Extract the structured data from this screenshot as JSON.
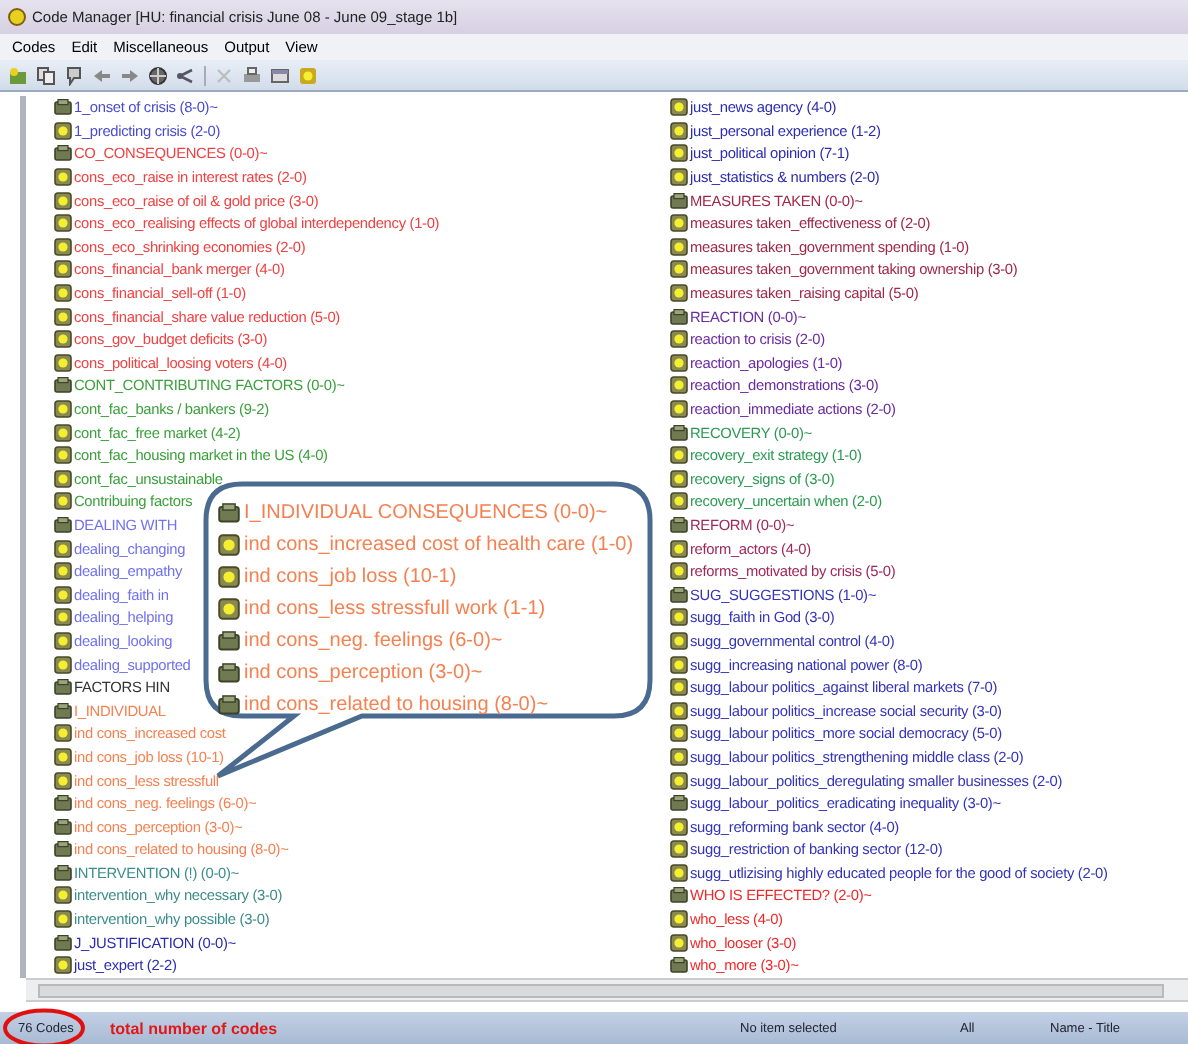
{
  "window": {
    "title": "Code Manager [HU: financial crisis June 08 - June 09_stage 1b]"
  },
  "menu": [
    "Codes",
    "Edit",
    "Miscellaneous",
    "Output",
    "View"
  ],
  "codes_left": [
    {
      "label": "1_onset of crisis (8-0)~",
      "kind": "group",
      "color": "#4a4ad0"
    },
    {
      "label": "1_predicting crisis (2-0)",
      "kind": "code",
      "color": "#4a4ad0"
    },
    {
      "label": "CO_CONSEQUENCES (0-0)~",
      "kind": "group",
      "color": "#f04040"
    },
    {
      "label": "cons_eco_raise in interest rates (2-0)",
      "kind": "code",
      "color": "#f04040"
    },
    {
      "label": "cons_eco_raise of oil & gold price (3-0)",
      "kind": "code",
      "color": "#f04040"
    },
    {
      "label": "cons_eco_realising effects of global interdependency (1-0)",
      "kind": "code",
      "color": "#f04040"
    },
    {
      "label": "cons_eco_shrinking economies (2-0)",
      "kind": "code",
      "color": "#f04040"
    },
    {
      "label": "cons_financial_bank merger (4-0)",
      "kind": "code",
      "color": "#f04040"
    },
    {
      "label": "cons_financial_sell-off (1-0)",
      "kind": "code",
      "color": "#f04040"
    },
    {
      "label": "cons_financial_share value reduction (5-0)",
      "kind": "code",
      "color": "#f04040"
    },
    {
      "label": "cons_gov_budget deficits (3-0)",
      "kind": "code",
      "color": "#f04040"
    },
    {
      "label": "cons_political_loosing voters (4-0)",
      "kind": "code",
      "color": "#f04040"
    },
    {
      "label": "CONT_CONTRIBUTING FACTORS (0-0)~",
      "kind": "group",
      "color": "#3aa03a"
    },
    {
      "label": "cont_fac_banks / bankers (9-2)",
      "kind": "code",
      "color": "#3aa03a"
    },
    {
      "label": "cont_fac_free market (4-2)",
      "kind": "code",
      "color": "#3aa03a"
    },
    {
      "label": "cont_fac_housing market in the US (4-0)",
      "kind": "code",
      "color": "#3aa03a"
    },
    {
      "label": "cont_fac_unsustainable",
      "kind": "code",
      "color": "#3aa03a"
    },
    {
      "label": "Contribuing factors",
      "kind": "code",
      "color": "#3aa03a"
    },
    {
      "label": "DEALING WITH",
      "kind": "group",
      "color": "#7070f0"
    },
    {
      "label": "dealing_changing",
      "kind": "code",
      "color": "#7070f0"
    },
    {
      "label": "dealing_empathy",
      "kind": "code",
      "color": "#7070f0"
    },
    {
      "label": "dealing_faith in",
      "kind": "code",
      "color": "#7070f0"
    },
    {
      "label": "dealing_helping",
      "kind": "code",
      "color": "#7070f0"
    },
    {
      "label": "dealing_looking",
      "kind": "code",
      "color": "#7070f0"
    },
    {
      "label": "dealing_supported",
      "kind": "code",
      "color": "#7070f0"
    },
    {
      "label": "FACTORS HIN",
      "kind": "group",
      "color": "#333333"
    },
    {
      "label": "I_INDIVIDUAL",
      "kind": "group",
      "color": "#f58050"
    },
    {
      "label": "ind cons_increased cost",
      "kind": "code",
      "color": "#f58050"
    },
    {
      "label": "ind cons_job loss (10-1)",
      "kind": "code",
      "color": "#f58050"
    },
    {
      "label": "ind cons_less stressfull",
      "kind": "code",
      "color": "#f58050"
    },
    {
      "label": "ind cons_neg. feelings (6-0)~",
      "kind": "group",
      "color": "#f58050"
    },
    {
      "label": "ind cons_perception (3-0)~",
      "kind": "group",
      "color": "#f58050"
    },
    {
      "label": "ind cons_related to housing (8-0)~",
      "kind": "group",
      "color": "#f58050"
    },
    {
      "label": "INTERVENTION (!) (0-0)~",
      "kind": "group",
      "color": "#3c8c8c"
    },
    {
      "label": "intervention_why necessary (3-0)",
      "kind": "code",
      "color": "#3c8c8c"
    },
    {
      "label": "intervention_why possible (3-0)",
      "kind": "code",
      "color": "#3c8c8c"
    },
    {
      "label": "J_JUSTIFICATION (0-0)~",
      "kind": "group",
      "color": "#2c2cb0"
    },
    {
      "label": "just_expert (2-2)",
      "kind": "code",
      "color": "#2c2cb0"
    }
  ],
  "codes_right": [
    {
      "label": "just_news agency (4-0)",
      "kind": "code",
      "color": "#2c2cb0"
    },
    {
      "label": "just_personal experience (1-2)",
      "kind": "code",
      "color": "#2c2cb0"
    },
    {
      "label": "just_political opinion (7-1)",
      "kind": "code",
      "color": "#2c2cb0"
    },
    {
      "label": "just_statistics & numbers (2-0)",
      "kind": "code",
      "color": "#2c2cb0"
    },
    {
      "label": "MEASURES TAKEN (0-0)~",
      "kind": "group",
      "color": "#a02848"
    },
    {
      "label": "measures taken_effectiveness of (2-0)",
      "kind": "code",
      "color": "#a02848"
    },
    {
      "label": "measures taken_government spending (1-0)",
      "kind": "code",
      "color": "#a02848"
    },
    {
      "label": "measures taken_government taking ownership (3-0)",
      "kind": "code",
      "color": "#a02848"
    },
    {
      "label": "measures taken_raising capital (5-0)",
      "kind": "code",
      "color": "#a02848"
    },
    {
      "label": "REACTION (0-0)~",
      "kind": "group",
      "color": "#6a2aa0"
    },
    {
      "label": "reaction to crisis (2-0)",
      "kind": "code",
      "color": "#6a2aa0"
    },
    {
      "label": "reaction_apologies (1-0)",
      "kind": "code",
      "color": "#6a2aa0"
    },
    {
      "label": "reaction_demonstrations (3-0)",
      "kind": "code",
      "color": "#6a2aa0"
    },
    {
      "label": "reaction_immediate actions (2-0)",
      "kind": "code",
      "color": "#6a2aa0"
    },
    {
      "label": "RECOVERY (0-0)~",
      "kind": "group",
      "color": "#2a9a50"
    },
    {
      "label": "recovery_exit strategy (1-0)",
      "kind": "code",
      "color": "#2a9a50"
    },
    {
      "label": "recovery_signs of (3-0)",
      "kind": "code",
      "color": "#2a9a50"
    },
    {
      "label": "recovery_uncertain when (2-0)",
      "kind": "code",
      "color": "#2a9a50"
    },
    {
      "label": "REFORM (0-0)~",
      "kind": "group",
      "color": "#a02858"
    },
    {
      "label": "reform_actors (4-0)",
      "kind": "code",
      "color": "#a02858"
    },
    {
      "label": "reforms_motivated by crisis (5-0)",
      "kind": "code",
      "color": "#a02858"
    },
    {
      "label": "SUG_SUGGESTIONS (1-0)~",
      "kind": "group",
      "color": "#3434b8"
    },
    {
      "label": "sugg_faith in God (3-0)",
      "kind": "code",
      "color": "#3434b8"
    },
    {
      "label": "sugg_governmental control (4-0)",
      "kind": "code",
      "color": "#3434b8"
    },
    {
      "label": "sugg_increasing national power (8-0)",
      "kind": "code",
      "color": "#3434b8"
    },
    {
      "label": "sugg_labour politics_against liberal markets (7-0)",
      "kind": "code",
      "color": "#3434b8"
    },
    {
      "label": "sugg_labour politics_increase social security (3-0)",
      "kind": "code",
      "color": "#3434b8"
    },
    {
      "label": "sugg_labour politics_more social democracy (5-0)",
      "kind": "code",
      "color": "#3434b8"
    },
    {
      "label": "sugg_labour politics_strengthening middle class (2-0)",
      "kind": "code",
      "color": "#3434b8"
    },
    {
      "label": "sugg_labour_politics_deregulating smaller businesses (2-0)",
      "kind": "code",
      "color": "#3434b8"
    },
    {
      "label": "sugg_labour_politics_eradicating inequality (3-0)~",
      "kind": "group",
      "color": "#3434b8"
    },
    {
      "label": "sugg_reforming bank sector (4-0)",
      "kind": "code",
      "color": "#3434b8"
    },
    {
      "label": "sugg_restriction of banking sector (12-0)",
      "kind": "code",
      "color": "#3434b8"
    },
    {
      "label": "sugg_utlizising highly educated people for the good of society (2-0)",
      "kind": "code",
      "color": "#3434b8"
    },
    {
      "label": "WHO IS EFFECTED? (2-0)~",
      "kind": "group",
      "color": "#f02828"
    },
    {
      "label": "who_less (4-0)",
      "kind": "code",
      "color": "#f02828"
    },
    {
      "label": "who_looser (3-0)",
      "kind": "code",
      "color": "#f02828"
    },
    {
      "label": "who_more (3-0)~",
      "kind": "group",
      "color": "#f02828"
    }
  ],
  "callout": {
    "items": [
      {
        "label": "I_INDIVIDUAL CONSEQUENCES (0-0)~",
        "kind": "group",
        "color": "#f58050"
      },
      {
        "label": "ind cons_increased cost of health care (1-0)",
        "kind": "code",
        "color": "#f58050"
      },
      {
        "label": "ind cons_job loss (10-1)",
        "kind": "code",
        "color": "#f58050"
      },
      {
        "label": "ind cons_less stressfull work (1-1)",
        "kind": "code",
        "color": "#f58050"
      },
      {
        "label": "ind cons_neg. feelings (6-0)~",
        "kind": "group",
        "color": "#f58050"
      },
      {
        "label": "ind cons_perception (3-0)~",
        "kind": "group",
        "color": "#f58050"
      },
      {
        "label": "ind cons_related to housing (8-0)~",
        "kind": "group",
        "color": "#f58050"
      }
    ]
  },
  "status_bar": {
    "count": "76 Codes",
    "annotation": "total number of codes",
    "selection": "No item selected",
    "filter": "All",
    "sort": "Name - Title"
  }
}
